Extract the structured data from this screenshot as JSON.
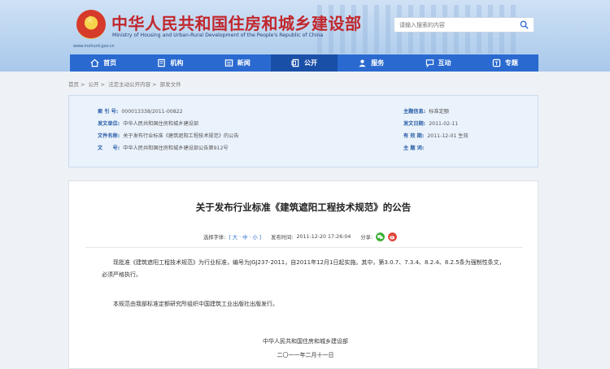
{
  "header": {
    "title": "中华人民共和国住房和城乡建设部",
    "subtitle": "Ministry of Housing and Urban-Rural Development of the People's Republic of China",
    "url": "www.mohurd.gov.cn",
    "search_placeholder": "请输入搜索的内容"
  },
  "nav": {
    "items": [
      {
        "label": "首页",
        "icon": "home-icon"
      },
      {
        "label": "机构",
        "icon": "building-icon"
      },
      {
        "label": "新闻",
        "icon": "news-icon"
      },
      {
        "label": "公开",
        "icon": "document-icon"
      },
      {
        "label": "服务",
        "icon": "service-icon"
      },
      {
        "label": "互动",
        "icon": "chat-icon"
      },
      {
        "label": "专题",
        "icon": "topic-icon"
      }
    ],
    "active": "公开"
  },
  "breadcrumb": [
    "首页",
    "公开",
    "法定主动公开内容",
    "部发文件"
  ],
  "meta": {
    "index_label": "索 引 号:",
    "index_value": "000013338/2011-00822",
    "issuer_label": "发文单位:",
    "issuer_value": "中华人民共和国住房和城乡建设部",
    "name_label": "文件名称:",
    "name_value": "关于发布行业标准《建筑遮阳工程技术规范》的公告",
    "docno_label": "文　　号:",
    "docno_value": "中华人民共和国住房和城乡建设部公告第912号",
    "category_label": "主题信息:",
    "category_value": "标准定额",
    "date_label": "发文日期:",
    "date_value": "2011-02-11",
    "valid_label": "有 效 期:",
    "valid_value": "2011-12-01 生效",
    "keywords_label": "主 题 词:",
    "keywords_value": ""
  },
  "article": {
    "title": "关于发布行业标准《建筑遮阳工程技术规范》的公告",
    "font_label": "选择字体:",
    "font_options": "[ 大 · 中 · 小 ]",
    "publish_label": "发布时间:",
    "publish_time": "2011-12-20 17:26:04",
    "share_label": "分享:",
    "para1": "现批准《建筑遮阳工程技术规范》为行业标准，编号为JGJ237-2011，自2011年12月1日起实施。其中，第3.0.7、7.3.4、8.2.4、8.2.5条为强制性条文，必须严格执行。",
    "para2": "本规范由我部标准定额研究所组织中国建筑工业出版社出版发行。",
    "sign_org": "中华人民共和国住房和城乡建设部",
    "sign_date": "二〇一一年二月十一日"
  },
  "colors": {
    "nav_blue": "#2a6ad0",
    "title_red": "#c1272d",
    "meta_bg": "#eaf2fb",
    "wechat_green": "#3cb035",
    "weibo_red": "#e0443a"
  }
}
